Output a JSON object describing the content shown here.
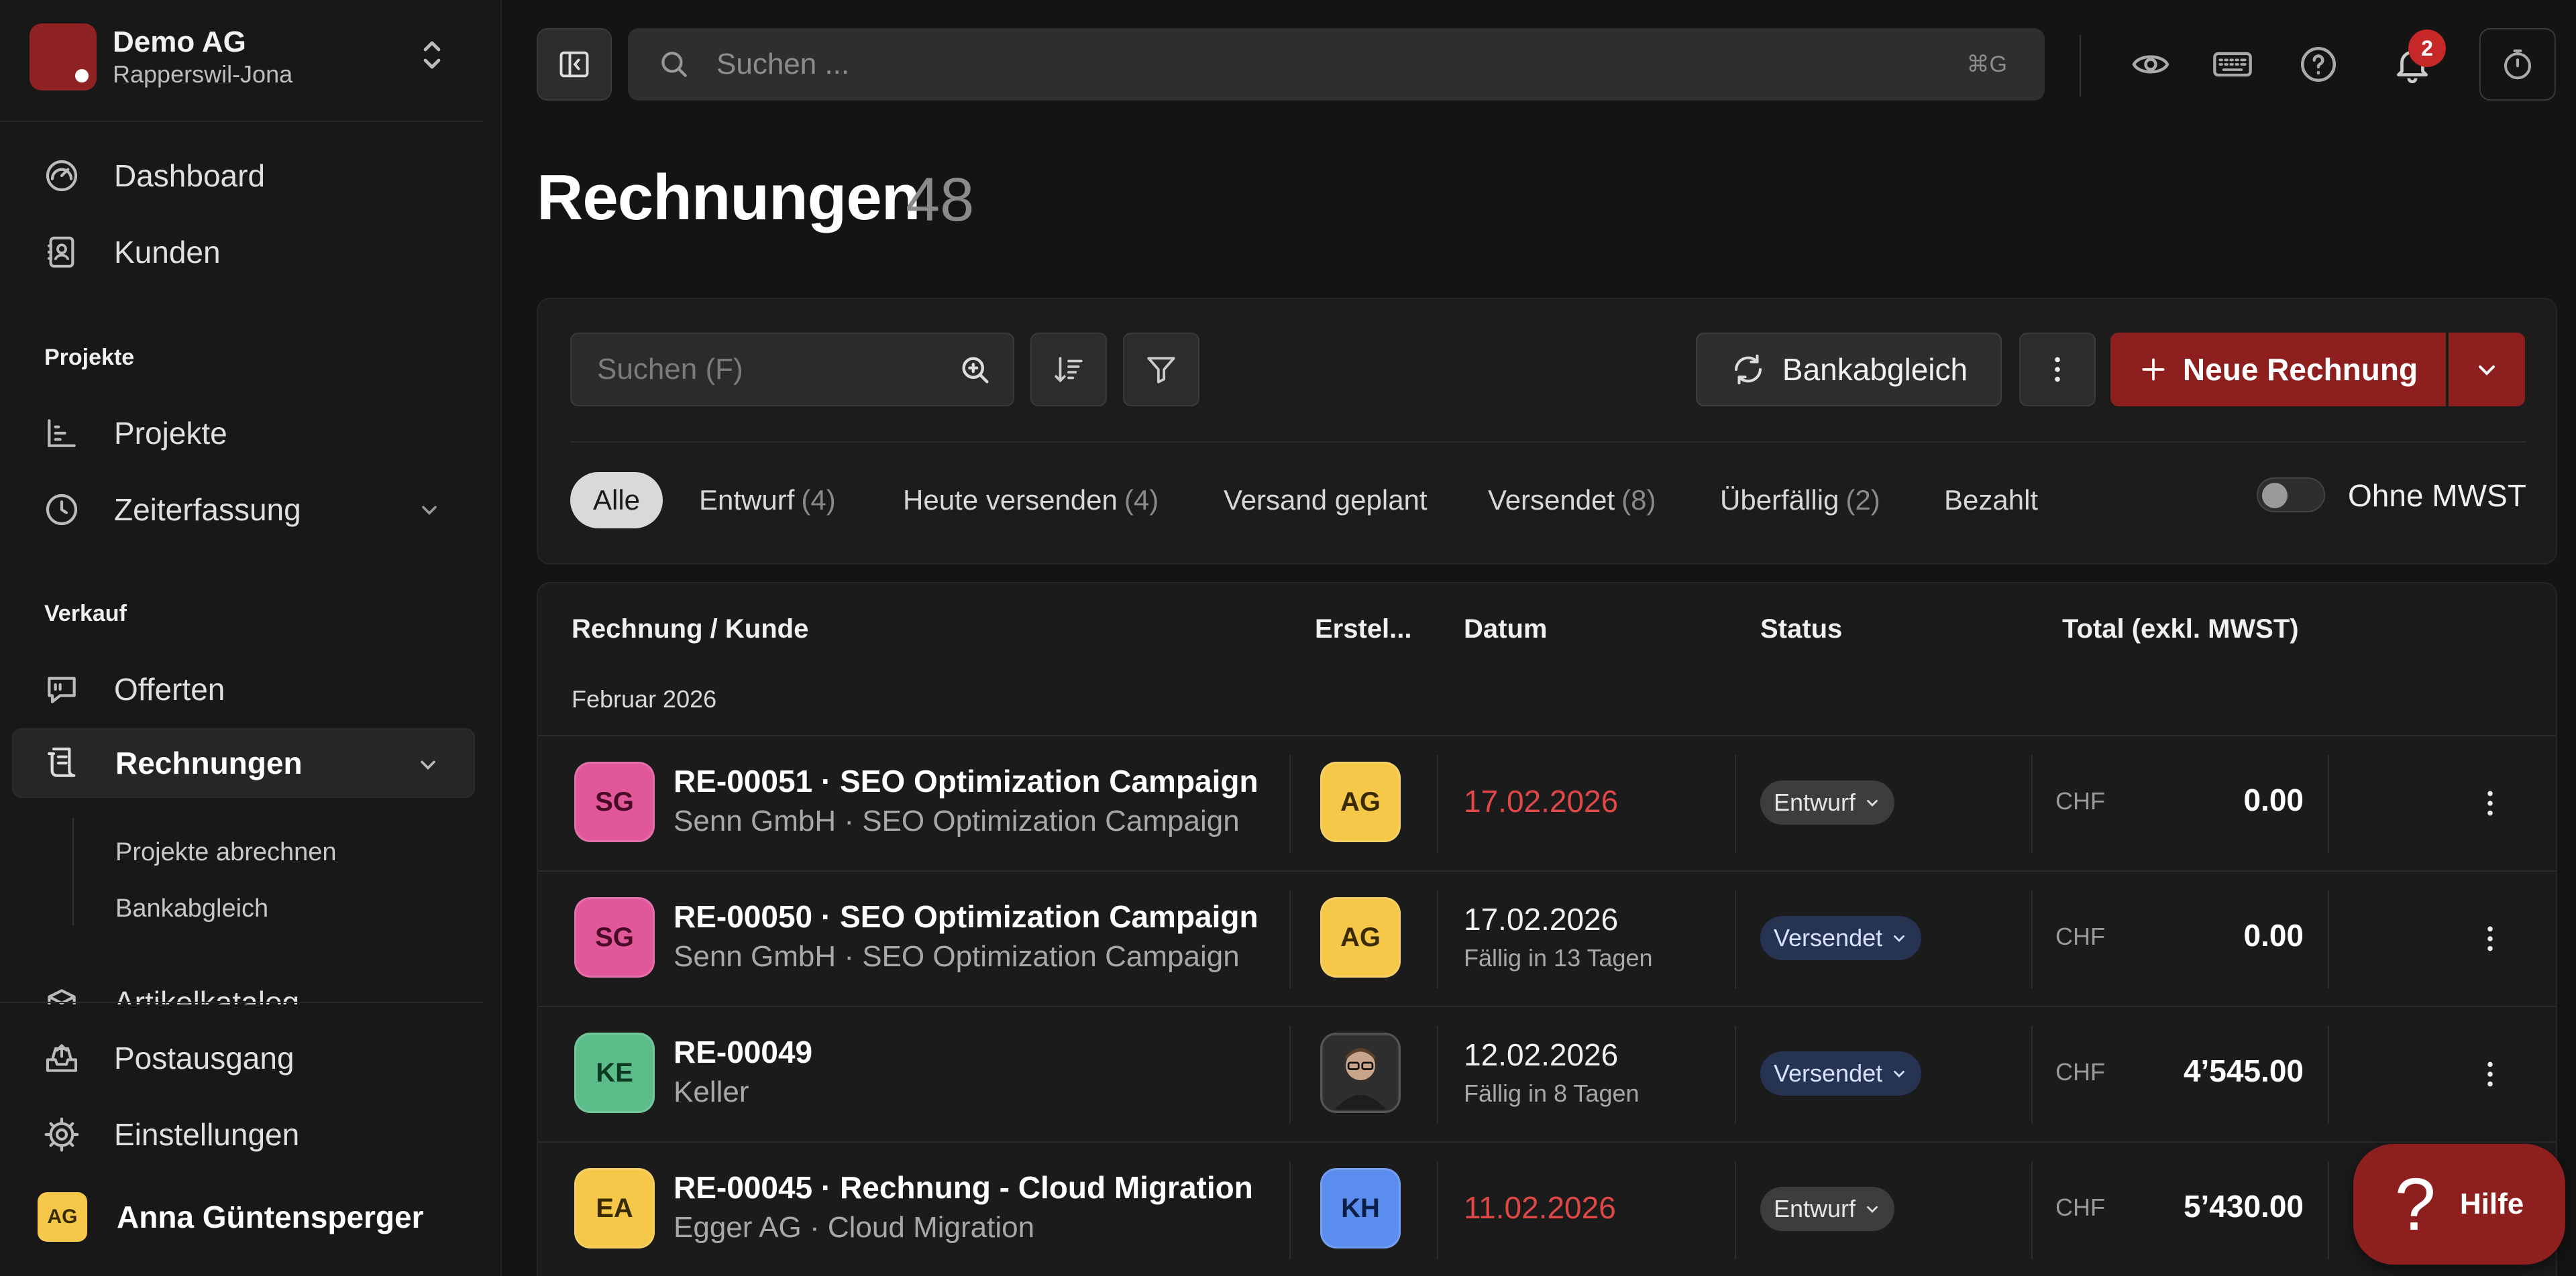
{
  "org": {
    "name": "Demo AG",
    "location": "Rapperswil-Jona"
  },
  "sidebar": {
    "top_items": [
      {
        "label": "Dashboard",
        "icon": "dashboard-icon"
      },
      {
        "label": "Kunden",
        "icon": "contacts-icon"
      }
    ],
    "sections": [
      {
        "title": "Projekte",
        "items": [
          {
            "label": "Projekte",
            "icon": "chart-icon"
          },
          {
            "label": "Zeiterfassung",
            "icon": "clock-icon"
          }
        ]
      },
      {
        "title": "Verkauf",
        "items": [
          {
            "label": "Offerten",
            "icon": "quote-icon"
          },
          {
            "label": "Rechnungen",
            "icon": "invoice-icon",
            "active": true
          },
          {
            "label": "Artikelkatalog",
            "icon": "box-icon"
          }
        ]
      }
    ],
    "sub_items": [
      "Projekte abrechnen",
      "Bankabgleich"
    ],
    "bottom_items": [
      {
        "label": "Postausgang",
        "icon": "outbox-icon"
      },
      {
        "label": "Einstellungen",
        "icon": "settings-icon"
      }
    ],
    "user": {
      "initials": "AG",
      "name": "Anna Güntensperger"
    }
  },
  "topbar": {
    "search_placeholder": "Suchen ...",
    "search_shortcut": "⌘G",
    "notification_count": "2"
  },
  "page": {
    "title": "Rechnungen",
    "count": "48"
  },
  "toolbar": {
    "search_placeholder": "Suchen (F)",
    "bank_label": "Bankabgleich",
    "new_label": "Neue Rechnung"
  },
  "filters": [
    {
      "label": "Alle",
      "count": "",
      "active": true
    },
    {
      "label": "Entwurf",
      "count": "(4)"
    },
    {
      "label": "Heute versenden",
      "count": "(4)"
    },
    {
      "label": "Versand geplant",
      "count": ""
    },
    {
      "label": "Versendet",
      "count": "(8)"
    },
    {
      "label": "Überfällig",
      "count": "(2)"
    },
    {
      "label": "Bezahlt",
      "count": ""
    }
  ],
  "mwst_toggle": {
    "label": "Ohne MWST",
    "on": false
  },
  "table": {
    "headers": {
      "invoice": "Rechnung / Kunde",
      "creator": "Erstel...",
      "date": "Datum",
      "status": "Status",
      "total": "Total (exkl. MWST)"
    },
    "group": "Februar 2026",
    "rows": [
      {
        "avatar": "SG",
        "avatar_color": "#e0579a",
        "title": "RE-00051 · SEO Optimization Campaign",
        "subtitle": "Senn GmbH · SEO Optimization Campaign",
        "creator": "AG",
        "creator_color": "#f5c84a",
        "date": "17.02.2026",
        "overdue": true,
        "due": "",
        "status": "Entwurf",
        "status_color": "#3d3d3d",
        "currency": "CHF",
        "amount": "0.00"
      },
      {
        "avatar": "SG",
        "avatar_color": "#e0579a",
        "title": "RE-00050 · SEO Optimization Campaign",
        "subtitle": "Senn GmbH · SEO Optimization Campaign",
        "creator": "AG",
        "creator_color": "#f5c84a",
        "date": "17.02.2026",
        "overdue": false,
        "due": "Fällig in 13 Tagen",
        "status": "Versendet",
        "status_color": "#263452",
        "currency": "CHF",
        "amount": "0.00"
      },
      {
        "avatar": "KE",
        "avatar_color": "#5cbd8a",
        "title": "RE-00049",
        "subtitle": "Keller",
        "creator": "photo",
        "creator_color": "#2a2a2a",
        "date": "12.02.2026",
        "overdue": false,
        "due": "Fällig in 8 Tagen",
        "status": "Versendet",
        "status_color": "#263452",
        "currency": "CHF",
        "amount": "4’545.00"
      },
      {
        "avatar": "EA",
        "avatar_color": "#f5c84a",
        "title": "RE-00045 · Rechnung - Cloud Migration",
        "subtitle": "Egger AG · Cloud Migration",
        "creator": "KH",
        "creator_color": "#5b8def",
        "date": "11.02.2026",
        "overdue": true,
        "due": "",
        "status": "Entwurf",
        "status_color": "#3d3d3d",
        "currency": "CHF",
        "amount": "5’430.00"
      }
    ]
  },
  "help": {
    "label": "Hilfe"
  }
}
